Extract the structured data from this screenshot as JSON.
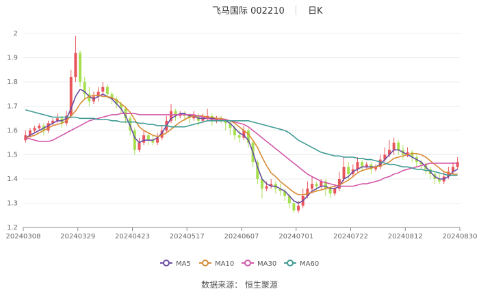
{
  "header": {
    "name": "飞马国际 002210",
    "period": "日K"
  },
  "footer": {
    "source": "数据来源： 恒生聚源"
  },
  "colors": {
    "up": "#e8555a",
    "down": "#a6e051",
    "grid": "#e9ecf2",
    "axis": "#888888"
  },
  "chart_data": {
    "type": "line",
    "title": "飞马国际 002210 日K",
    "ylim": [
      1.2,
      2.0
    ],
    "yticks": [
      "1.2",
      "1.3",
      "1.4",
      "1.5",
      "1.6",
      "1.7",
      "1.8",
      "1.9",
      "2"
    ],
    "xlabels": [
      "20240308",
      "20240329",
      "20240423",
      "20240517",
      "20240607",
      "20240701",
      "20240722",
      "20240812",
      "20240830"
    ],
    "legend_position": "bottom",
    "candles_approx": [
      [
        1.56,
        1.58,
        1.55,
        1.6
      ],
      [
        1.58,
        1.6,
        1.57,
        1.61
      ],
      [
        1.6,
        1.61,
        1.59,
        1.62
      ],
      [
        1.61,
        1.62,
        1.6,
        1.63
      ],
      [
        1.62,
        1.6,
        1.58,
        1.63
      ],
      [
        1.6,
        1.63,
        1.59,
        1.64
      ],
      [
        1.63,
        1.64,
        1.62,
        1.65
      ],
      [
        1.64,
        1.65,
        1.63,
        1.67
      ],
      [
        1.65,
        1.63,
        1.61,
        1.66
      ],
      [
        1.63,
        1.66,
        1.62,
        1.68
      ],
      [
        1.66,
        1.82,
        1.65,
        1.85
      ],
      [
        1.82,
        1.92,
        1.8,
        1.99
      ],
      [
        1.92,
        1.8,
        1.78,
        1.93
      ],
      [
        1.8,
        1.75,
        1.73,
        1.82
      ],
      [
        1.75,
        1.72,
        1.7,
        1.78
      ],
      [
        1.72,
        1.74,
        1.71,
        1.76
      ],
      [
        1.74,
        1.76,
        1.72,
        1.78
      ],
      [
        1.76,
        1.78,
        1.74,
        1.8
      ],
      [
        1.78,
        1.75,
        1.73,
        1.79
      ],
      [
        1.75,
        1.73,
        1.71,
        1.76
      ],
      [
        1.73,
        1.71,
        1.69,
        1.74
      ],
      [
        1.71,
        1.69,
        1.67,
        1.72
      ],
      [
        1.69,
        1.65,
        1.63,
        1.7
      ],
      [
        1.65,
        1.6,
        1.58,
        1.66
      ],
      [
        1.6,
        1.52,
        1.5,
        1.61
      ],
      [
        1.52,
        1.55,
        1.51,
        1.57
      ],
      [
        1.55,
        1.58,
        1.54,
        1.6
      ],
      [
        1.58,
        1.56,
        1.54,
        1.59
      ],
      [
        1.56,
        1.55,
        1.54,
        1.58
      ],
      [
        1.55,
        1.57,
        1.54,
        1.59
      ],
      [
        1.57,
        1.6,
        1.56,
        1.62
      ],
      [
        1.6,
        1.64,
        1.59,
        1.66
      ],
      [
        1.64,
        1.68,
        1.63,
        1.71
      ],
      [
        1.68,
        1.66,
        1.64,
        1.69
      ],
      [
        1.66,
        1.67,
        1.65,
        1.68
      ],
      [
        1.67,
        1.66,
        1.64,
        1.68
      ],
      [
        1.66,
        1.65,
        1.63,
        1.67
      ],
      [
        1.65,
        1.66,
        1.64,
        1.68
      ],
      [
        1.66,
        1.64,
        1.62,
        1.67
      ],
      [
        1.64,
        1.65,
        1.63,
        1.67
      ],
      [
        1.65,
        1.66,
        1.64,
        1.69
      ],
      [
        1.66,
        1.64,
        1.62,
        1.67
      ],
      [
        1.64,
        1.65,
        1.63,
        1.66
      ],
      [
        1.65,
        1.64,
        1.63,
        1.66
      ],
      [
        1.64,
        1.63,
        1.6,
        1.65
      ],
      [
        1.63,
        1.61,
        1.58,
        1.64
      ],
      [
        1.61,
        1.58,
        1.56,
        1.62
      ],
      [
        1.58,
        1.57,
        1.55,
        1.6
      ],
      [
        1.57,
        1.6,
        1.56,
        1.62
      ],
      [
        1.6,
        1.55,
        1.53,
        1.61
      ],
      [
        1.55,
        1.47,
        1.45,
        1.56
      ],
      [
        1.47,
        1.4,
        1.38,
        1.48
      ],
      [
        1.4,
        1.36,
        1.32,
        1.41
      ],
      [
        1.36,
        1.37,
        1.35,
        1.39
      ],
      [
        1.37,
        1.38,
        1.36,
        1.4
      ],
      [
        1.38,
        1.36,
        1.34,
        1.39
      ],
      [
        1.36,
        1.35,
        1.33,
        1.38
      ],
      [
        1.35,
        1.33,
        1.31,
        1.36
      ],
      [
        1.33,
        1.3,
        1.28,
        1.34
      ],
      [
        1.3,
        1.27,
        1.26,
        1.31
      ],
      [
        1.27,
        1.29,
        1.26,
        1.31
      ],
      [
        1.29,
        1.33,
        1.28,
        1.36
      ],
      [
        1.33,
        1.36,
        1.32,
        1.39
      ],
      [
        1.36,
        1.38,
        1.34,
        1.41
      ],
      [
        1.38,
        1.37,
        1.35,
        1.39
      ],
      [
        1.37,
        1.39,
        1.36,
        1.4
      ],
      [
        1.39,
        1.36,
        1.33,
        1.4
      ],
      [
        1.36,
        1.34,
        1.32,
        1.37
      ],
      [
        1.34,
        1.36,
        1.33,
        1.38
      ],
      [
        1.36,
        1.4,
        1.35,
        1.43
      ],
      [
        1.4,
        1.45,
        1.39,
        1.49
      ],
      [
        1.45,
        1.42,
        1.4,
        1.47
      ],
      [
        1.42,
        1.44,
        1.41,
        1.46
      ],
      [
        1.44,
        1.47,
        1.43,
        1.49
      ],
      [
        1.47,
        1.45,
        1.43,
        1.48
      ],
      [
        1.45,
        1.46,
        1.44,
        1.47
      ],
      [
        1.46,
        1.44,
        1.42,
        1.47
      ],
      [
        1.44,
        1.45,
        1.43,
        1.46
      ],
      [
        1.45,
        1.48,
        1.44,
        1.5
      ],
      [
        1.48,
        1.5,
        1.47,
        1.53
      ],
      [
        1.5,
        1.52,
        1.49,
        1.56
      ],
      [
        1.52,
        1.55,
        1.5,
        1.57
      ],
      [
        1.55,
        1.52,
        1.5,
        1.56
      ],
      [
        1.52,
        1.5,
        1.48,
        1.54
      ],
      [
        1.5,
        1.51,
        1.49,
        1.53
      ],
      [
        1.51,
        1.49,
        1.47,
        1.52
      ],
      [
        1.49,
        1.47,
        1.45,
        1.5
      ],
      [
        1.47,
        1.46,
        1.44,
        1.48
      ],
      [
        1.46,
        1.44,
        1.42,
        1.47
      ],
      [
        1.44,
        1.42,
        1.4,
        1.45
      ],
      [
        1.42,
        1.4,
        1.38,
        1.43
      ],
      [
        1.4,
        1.39,
        1.38,
        1.42
      ],
      [
        1.39,
        1.41,
        1.38,
        1.43
      ],
      [
        1.41,
        1.43,
        1.4,
        1.45
      ],
      [
        1.43,
        1.45,
        1.42,
        1.47
      ],
      [
        1.45,
        1.47,
        1.44,
        1.49
      ]
    ],
    "series": [
      {
        "name": "MA5",
        "color": "#6a4aa5",
        "values": [
          1.57,
          1.58,
          1.59,
          1.6,
          1.61,
          1.62,
          1.63,
          1.64,
          1.64,
          1.65,
          1.69,
          1.74,
          1.77,
          1.76,
          1.74,
          1.73,
          1.74,
          1.75,
          1.74,
          1.73,
          1.71,
          1.69,
          1.66,
          1.62,
          1.57,
          1.55,
          1.56,
          1.56,
          1.56,
          1.57,
          1.59,
          1.62,
          1.65,
          1.66,
          1.67,
          1.67,
          1.66,
          1.66,
          1.65,
          1.65,
          1.65,
          1.65,
          1.65,
          1.65,
          1.64,
          1.63,
          1.61,
          1.59,
          1.58,
          1.56,
          1.51,
          1.45,
          1.4,
          1.38,
          1.37,
          1.37,
          1.36,
          1.35,
          1.33,
          1.31,
          1.3,
          1.31,
          1.33,
          1.35,
          1.36,
          1.37,
          1.37,
          1.36,
          1.36,
          1.37,
          1.4,
          1.41,
          1.43,
          1.44,
          1.45,
          1.45,
          1.45,
          1.45,
          1.46,
          1.48,
          1.5,
          1.52,
          1.52,
          1.51,
          1.5,
          1.49,
          1.48,
          1.47,
          1.45,
          1.43,
          1.41,
          1.4,
          1.4,
          1.41,
          1.43,
          1.44
        ]
      },
      {
        "name": "MA10",
        "color": "#d98a33",
        "values": [
          1.57,
          1.575,
          1.58,
          1.59,
          1.6,
          1.61,
          1.62,
          1.625,
          1.63,
          1.64,
          1.66,
          1.68,
          1.71,
          1.73,
          1.74,
          1.745,
          1.745,
          1.74,
          1.74,
          1.735,
          1.725,
          1.71,
          1.695,
          1.675,
          1.645,
          1.615,
          1.6,
          1.59,
          1.58,
          1.575,
          1.58,
          1.59,
          1.605,
          1.62,
          1.635,
          1.645,
          1.655,
          1.66,
          1.66,
          1.66,
          1.655,
          1.655,
          1.65,
          1.65,
          1.645,
          1.64,
          1.63,
          1.615,
          1.6,
          1.585,
          1.56,
          1.53,
          1.49,
          1.455,
          1.425,
          1.41,
          1.39,
          1.375,
          1.36,
          1.345,
          1.335,
          1.335,
          1.34,
          1.345,
          1.35,
          1.355,
          1.36,
          1.365,
          1.37,
          1.375,
          1.385,
          1.395,
          1.41,
          1.425,
          1.435,
          1.44,
          1.445,
          1.45,
          1.455,
          1.46,
          1.47,
          1.485,
          1.49,
          1.495,
          1.5,
          1.505,
          1.505,
          1.5,
          1.49,
          1.475,
          1.46,
          1.445,
          1.43,
          1.425,
          1.42,
          1.42
        ]
      },
      {
        "name": "MA30",
        "color": "#d356a8",
        "values": [
          1.57,
          1.565,
          1.56,
          1.555,
          1.555,
          1.555,
          1.56,
          1.57,
          1.58,
          1.59,
          1.6,
          1.61,
          1.62,
          1.63,
          1.64,
          1.645,
          1.65,
          1.655,
          1.66,
          1.665,
          1.665,
          1.67,
          1.67,
          1.67,
          1.67,
          1.665,
          1.665,
          1.665,
          1.665,
          1.665,
          1.665,
          1.665,
          1.665,
          1.665,
          1.665,
          1.665,
          1.665,
          1.665,
          1.66,
          1.655,
          1.65,
          1.645,
          1.645,
          1.645,
          1.645,
          1.64,
          1.635,
          1.63,
          1.625,
          1.615,
          1.6,
          1.585,
          1.57,
          1.555,
          1.54,
          1.525,
          1.51,
          1.495,
          1.48,
          1.465,
          1.45,
          1.435,
          1.42,
          1.41,
          1.4,
          1.39,
          1.385,
          1.38,
          1.375,
          1.37,
          1.37,
          1.37,
          1.37,
          1.375,
          1.38,
          1.38,
          1.385,
          1.39,
          1.395,
          1.405,
          1.41,
          1.42,
          1.425,
          1.435,
          1.44,
          1.445,
          1.45,
          1.455,
          1.46,
          1.465,
          1.465,
          1.465,
          1.465,
          1.465,
          1.465,
          1.465
        ]
      },
      {
        "name": "MA60",
        "color": "#3e9a93",
        "values": [
          1.685,
          1.68,
          1.675,
          1.67,
          1.665,
          1.66,
          1.655,
          1.655,
          1.655,
          1.655,
          1.655,
          1.655,
          1.65,
          1.65,
          1.65,
          1.65,
          1.645,
          1.645,
          1.645,
          1.64,
          1.64,
          1.635,
          1.635,
          1.635,
          1.635,
          1.63,
          1.63,
          1.625,
          1.625,
          1.62,
          1.62,
          1.62,
          1.615,
          1.615,
          1.615,
          1.615,
          1.62,
          1.625,
          1.63,
          1.635,
          1.64,
          1.64,
          1.64,
          1.64,
          1.64,
          1.64,
          1.64,
          1.64,
          1.64,
          1.64,
          1.635,
          1.63,
          1.625,
          1.62,
          1.615,
          1.61,
          1.605,
          1.6,
          1.59,
          1.575,
          1.56,
          1.55,
          1.54,
          1.53,
          1.52,
          1.51,
          1.505,
          1.5,
          1.495,
          1.495,
          1.49,
          1.49,
          1.49,
          1.485,
          1.485,
          1.48,
          1.48,
          1.475,
          1.47,
          1.465,
          1.46,
          1.46,
          1.455,
          1.45,
          1.45,
          1.445,
          1.44,
          1.44,
          1.435,
          1.435,
          1.43,
          1.425,
          1.42,
          1.415,
          1.415,
          1.415
        ]
      }
    ]
  }
}
